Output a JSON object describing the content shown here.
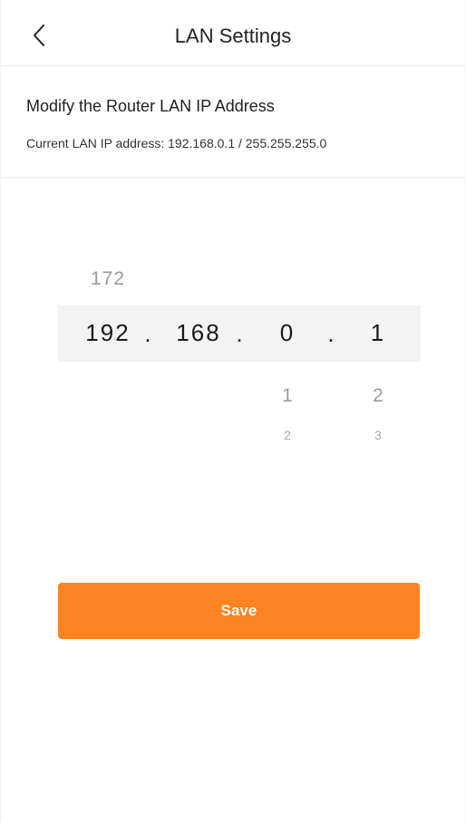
{
  "header": {
    "title": "LAN Settings",
    "back_icon": "chevron-left-icon"
  },
  "info": {
    "heading": "Modify the Router LAN IP Address",
    "current_ip_text": "Current LAN IP address: 192.168.0.1 / 255.255.255.0"
  },
  "picker": {
    "columns": [
      {
        "prev": "172",
        "selected": "192",
        "next": "",
        "next2": ""
      },
      {
        "prev": "",
        "selected": "168",
        "next": "",
        "next2": ""
      },
      {
        "prev": "",
        "selected": "0",
        "next": "1",
        "next2": "2"
      },
      {
        "prev": "",
        "selected": "1",
        "next": "2",
        "next2": "3"
      }
    ],
    "separator": "."
  },
  "actions": {
    "save_label": "Save"
  },
  "colors": {
    "accent": "#ff8320",
    "selection_band": "#f3f3f3"
  }
}
